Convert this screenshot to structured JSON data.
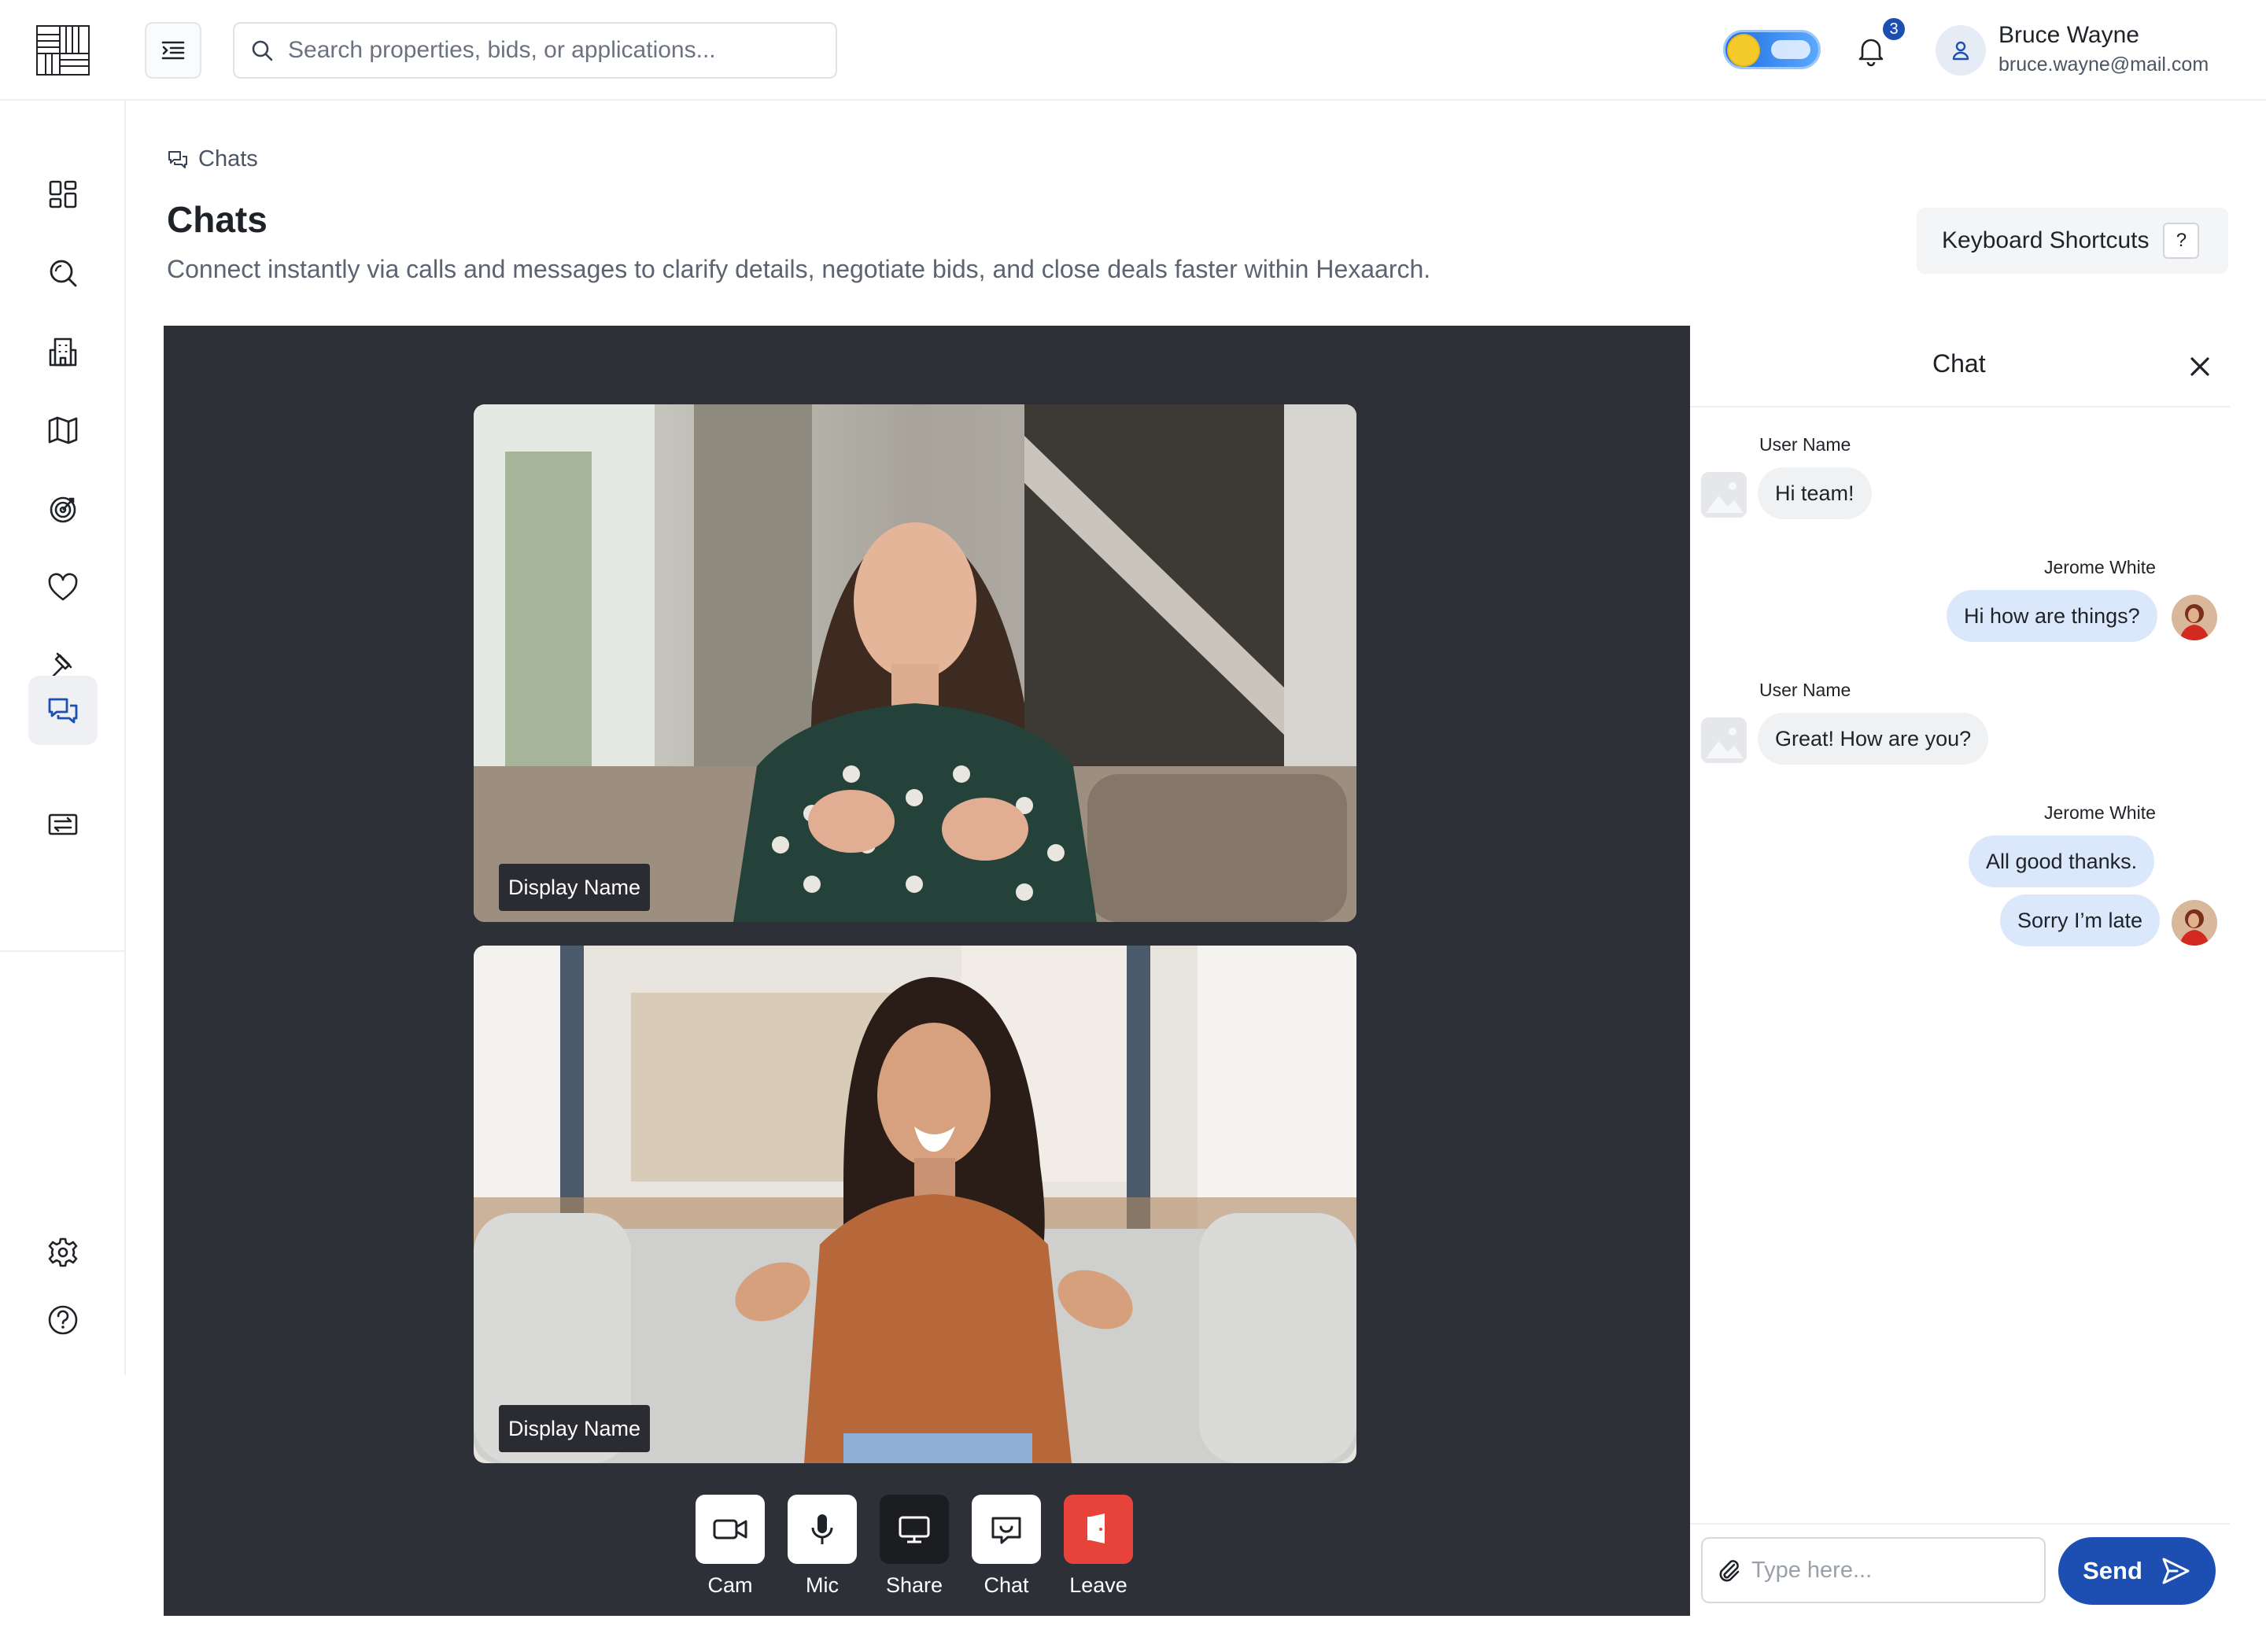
{
  "topbar": {
    "search_placeholder": "Search properties, bids, or applications...",
    "notification_count": "3",
    "user_name": "Bruce Wayne",
    "user_email": "bruce.wayne@mail.com"
  },
  "sidebar": {
    "items": [
      {
        "icon": "dashboard-icon"
      },
      {
        "icon": "search-icon"
      },
      {
        "icon": "building-icon"
      },
      {
        "icon": "map-icon"
      },
      {
        "icon": "target-icon"
      },
      {
        "icon": "heart-icon"
      },
      {
        "icon": "gavel-icon"
      },
      {
        "icon": "chat-icon",
        "active": true
      },
      {
        "icon": "transfer-icon"
      }
    ],
    "bottom": [
      {
        "icon": "settings-icon"
      },
      {
        "icon": "help-icon"
      }
    ]
  },
  "breadcrumb": {
    "label": "Chats"
  },
  "page": {
    "title": "Chats",
    "subtitle": "Connect instantly via calls and messages to clarify details, negotiate bids, and close deals faster within Hexaarch.",
    "keyboard_shortcuts_label": "Keyboard Shortcuts",
    "keyboard_shortcuts_key": "?"
  },
  "video": {
    "tiles": [
      {
        "display_name": "Display Name"
      },
      {
        "display_name": "Display Name"
      }
    ],
    "controls": [
      {
        "label": "Cam",
        "icon": "camera-icon"
      },
      {
        "label": "Mic",
        "icon": "microphone-icon"
      },
      {
        "label": "Share",
        "icon": "screen-share-icon"
      },
      {
        "label": "Chat",
        "icon": "chat-bubble-icon"
      },
      {
        "label": "Leave",
        "icon": "leave-icon"
      }
    ]
  },
  "chat": {
    "title": "Chat",
    "messages": [
      {
        "sender": "User Name",
        "text": "Hi team!",
        "direction": "in"
      },
      {
        "sender": "Jerome White",
        "text": "Hi how are things?",
        "direction": "out"
      },
      {
        "sender": "User Name",
        "text": "Great! How are you?",
        "direction": "in"
      },
      {
        "sender": "Jerome White",
        "text": "All good thanks.",
        "direction": "out"
      },
      {
        "sender": "",
        "text": "Sorry I’m late",
        "direction": "out"
      }
    ],
    "input_placeholder": "Type here...",
    "send_label": "Send"
  },
  "colors": {
    "accent": "#1d4fb3",
    "video_bg": "#2d3037",
    "leave_red": "#e8433a",
    "outgoing_bubble": "#dbe7fb",
    "incoming_bubble": "#f0f1f3"
  }
}
